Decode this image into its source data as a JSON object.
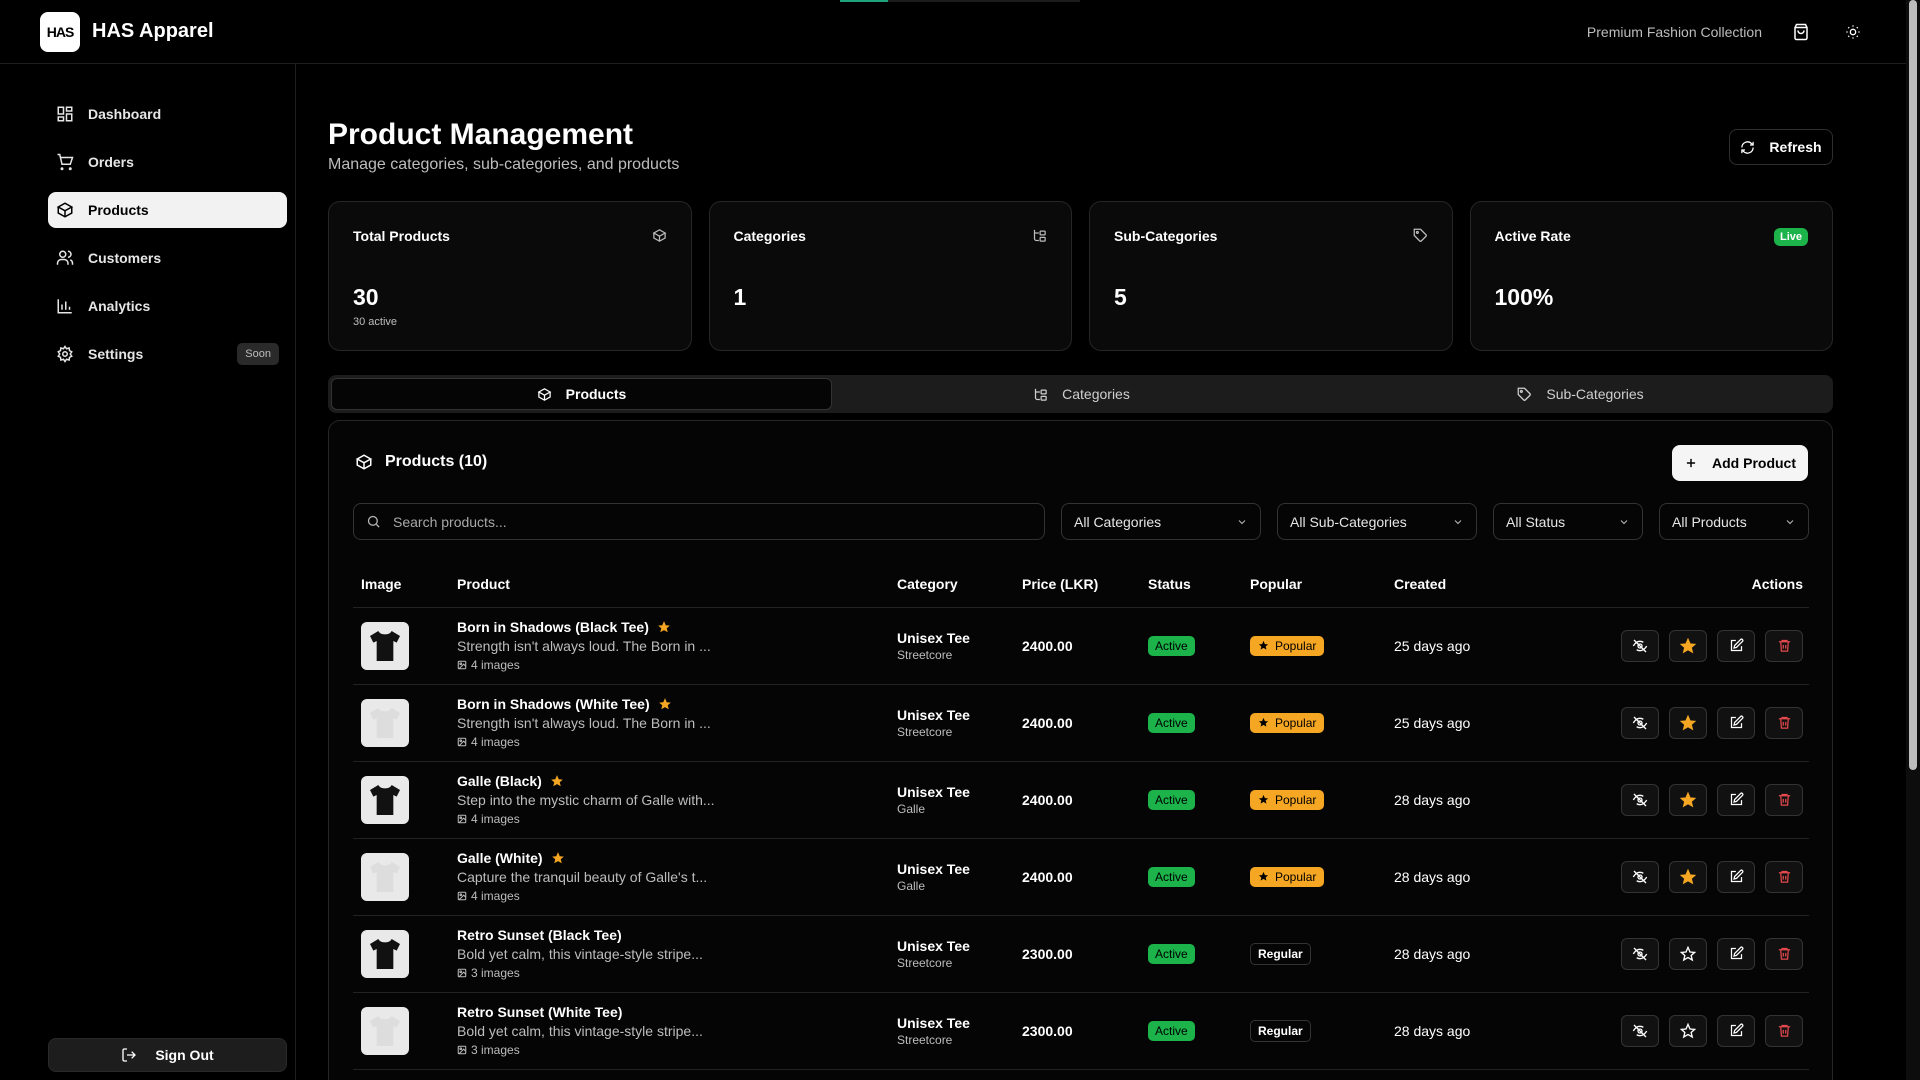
{
  "app": {
    "name": "HAS Apparel",
    "logo_text": "HAS",
    "tagline": "Premium Fashion Collection"
  },
  "sidebar": {
    "items": [
      {
        "label": "Dashboard",
        "icon": "grid-icon"
      },
      {
        "label": "Orders",
        "icon": "cart-icon"
      },
      {
        "label": "Products",
        "icon": "box-icon"
      },
      {
        "label": "Customers",
        "icon": "users-icon"
      },
      {
        "label": "Analytics",
        "icon": "bar-chart-icon"
      },
      {
        "label": "Settings",
        "icon": "gear-icon",
        "badge": "Soon"
      }
    ],
    "sign_out": "Sign Out"
  },
  "page": {
    "title": "Product Management",
    "subtitle": "Manage categories, sub-categories, and products",
    "refresh": "Refresh"
  },
  "stats": [
    {
      "label": "Total Products",
      "value": "30",
      "note": "30 active"
    },
    {
      "label": "Categories",
      "value": "1"
    },
    {
      "label": "Sub-Categories",
      "value": "5"
    },
    {
      "label": "Active Rate",
      "value": "100%",
      "badge": "Live"
    }
  ],
  "tabs": [
    "Products",
    "Categories",
    "Sub-Categories"
  ],
  "panel": {
    "title": "Products (10)",
    "add_button": "Add Product",
    "search_placeholder": "Search products...",
    "filters": [
      "All Categories",
      "All Sub-Categories",
      "All Status",
      "All Products"
    ]
  },
  "table": {
    "headers": [
      "Image",
      "Product",
      "Category",
      "Price (LKR)",
      "Status",
      "Popular",
      "Created",
      "Actions"
    ],
    "rows": [
      {
        "name": "Born in Shadows (Black Tee)",
        "desc": "Strength isn't always loud. The Born in ...",
        "images": "4 images",
        "category": "Unisex Tee",
        "subcategory": "Streetcore",
        "price": "2400.00",
        "status": "Active",
        "popular": "Popular",
        "created": "25 days ago",
        "starred": true,
        "shirt": "#111111"
      },
      {
        "name": "Born in Shadows (White Tee)",
        "desc": "Strength isn't always loud. The Born in ...",
        "images": "4 images",
        "category": "Unisex Tee",
        "subcategory": "Streetcore",
        "price": "2400.00",
        "status": "Active",
        "popular": "Popular",
        "created": "25 days ago",
        "starred": true,
        "shirt": "#dddddd"
      },
      {
        "name": "Galle (Black)",
        "desc": "Step into the mystic charm of Galle with...",
        "images": "4 images",
        "category": "Unisex Tee",
        "subcategory": "Galle",
        "price": "2400.00",
        "status": "Active",
        "popular": "Popular",
        "created": "28 days ago",
        "starred": true,
        "shirt": "#111111"
      },
      {
        "name": "Galle (White)",
        "desc": "Capture the tranquil beauty of Galle's t...",
        "images": "4 images",
        "category": "Unisex Tee",
        "subcategory": "Galle",
        "price": "2400.00",
        "status": "Active",
        "popular": "Popular",
        "created": "28 days ago",
        "starred": true,
        "shirt": "#dddddd"
      },
      {
        "name": "Retro Sunset (Black Tee)",
        "desc": "Bold yet calm, this vintage-style stripe...",
        "images": "3 images",
        "category": "Unisex Tee",
        "subcategory": "Streetcore",
        "price": "2300.00",
        "status": "Active",
        "popular": "Regular",
        "created": "28 days ago",
        "starred": false,
        "shirt": "#111111"
      },
      {
        "name": "Retro Sunset (White Tee)",
        "desc": "Bold yet calm, this vintage-style stripe...",
        "images": "3 images",
        "category": "Unisex Tee",
        "subcategory": "Streetcore",
        "price": "2300.00",
        "status": "Active",
        "popular": "Regular",
        "created": "28 days ago",
        "starred": false,
        "shirt": "#dddddd"
      }
    ]
  }
}
